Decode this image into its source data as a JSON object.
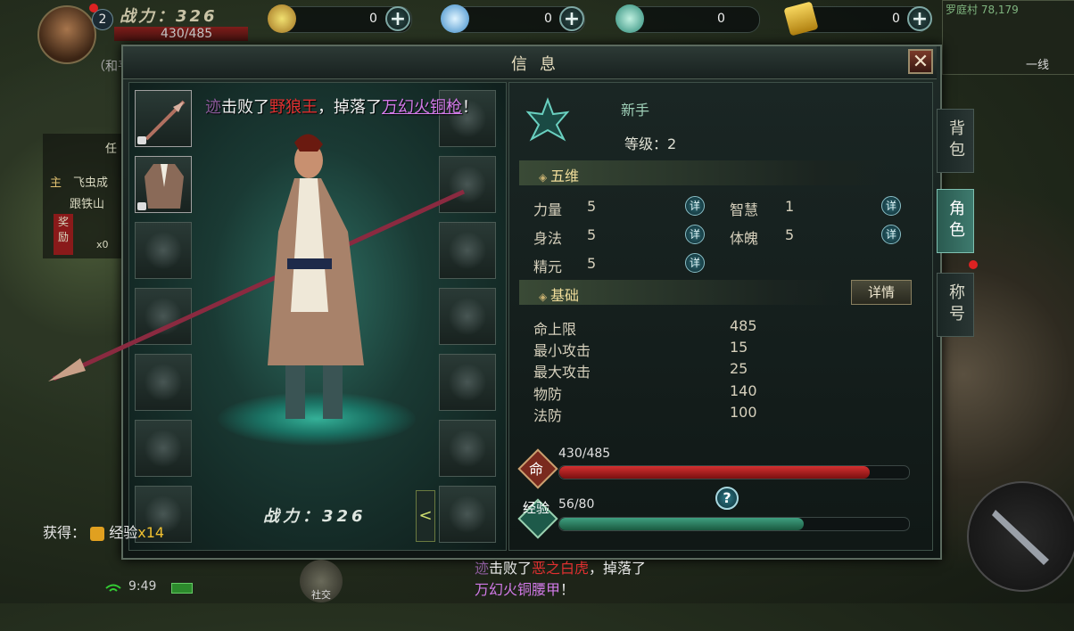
{
  "hud": {
    "level": "2",
    "power_label": "战力：326",
    "hp": "430/485",
    "pk_mode": "（和平",
    "currencies": [
      {
        "name": "gold-coin",
        "value": "0"
      },
      {
        "name": "bound-jade",
        "value": "0"
      },
      {
        "name": "spirit-crystal",
        "value": "0"
      },
      {
        "name": "gold-ticket",
        "value": "0"
      }
    ],
    "plus_symbol": "+",
    "map_name": "罗庭村 78,179",
    "map_line": "一线"
  },
  "quest": {
    "tab_label": "任",
    "lines": [
      "飞虫成",
      "跟铁山"
    ],
    "main_tag": "主",
    "reward_tag": "奖励",
    "reward_count": "x0"
  },
  "dialog": {
    "title": "信息",
    "close_symbol": "✕"
  },
  "left_panel": {
    "kill_msg_mark": "迹",
    "kill_msg_pre": "击败了",
    "kill_msg_monster": "野狼王",
    "kill_msg_mid": "，掉落了",
    "kill_msg_item": "万幻火铜枪",
    "kill_msg_end": "！",
    "power": "战力：326",
    "collapse_symbol": "<"
  },
  "character": {
    "rank": "新手",
    "level_label": "等级：",
    "level_value": "2"
  },
  "five_stats": {
    "header": "五维",
    "detail_symbol": "详",
    "stats": [
      {
        "label": "力量",
        "value": "5"
      },
      {
        "label": "智慧",
        "value": "1"
      },
      {
        "label": "身法",
        "value": "5"
      },
      {
        "label": "体魄",
        "value": "5"
      },
      {
        "label": "精元",
        "value": "5"
      }
    ]
  },
  "base_stats": {
    "header": "基础",
    "detail_button": "详情",
    "stats": [
      {
        "label": "命上限",
        "value": "485"
      },
      {
        "label": "最小攻击",
        "value": "15"
      },
      {
        "label": "最大攻击",
        "value": "25"
      },
      {
        "label": "物防",
        "value": "140"
      },
      {
        "label": "法防",
        "value": "100"
      }
    ]
  },
  "bars": {
    "hp_icon": "命",
    "hp_text": "430/485",
    "hp_fill": 0.887,
    "exp_icon": "经验",
    "exp_text": "56/80",
    "exp_fill": 0.7,
    "help_symbol": "?",
    "hp_color": "#d43030",
    "exp_color": "#3fa080"
  },
  "side_tabs": [
    {
      "label": "背包",
      "active": false
    },
    {
      "label": "角色",
      "active": true
    },
    {
      "label": "称号",
      "active": false
    }
  ],
  "bottom": {
    "gain_label": "获得：",
    "gain_item": "经验",
    "gain_amount": "x14",
    "time": "9:49",
    "chat_mark": "迹",
    "chat_pre": "击败了",
    "chat_monster": "恶之白虎",
    "chat_mid": "，掉落了",
    "chat_item": "万幻火铜腰甲",
    "chat_end": "！",
    "social_label": "社交"
  }
}
